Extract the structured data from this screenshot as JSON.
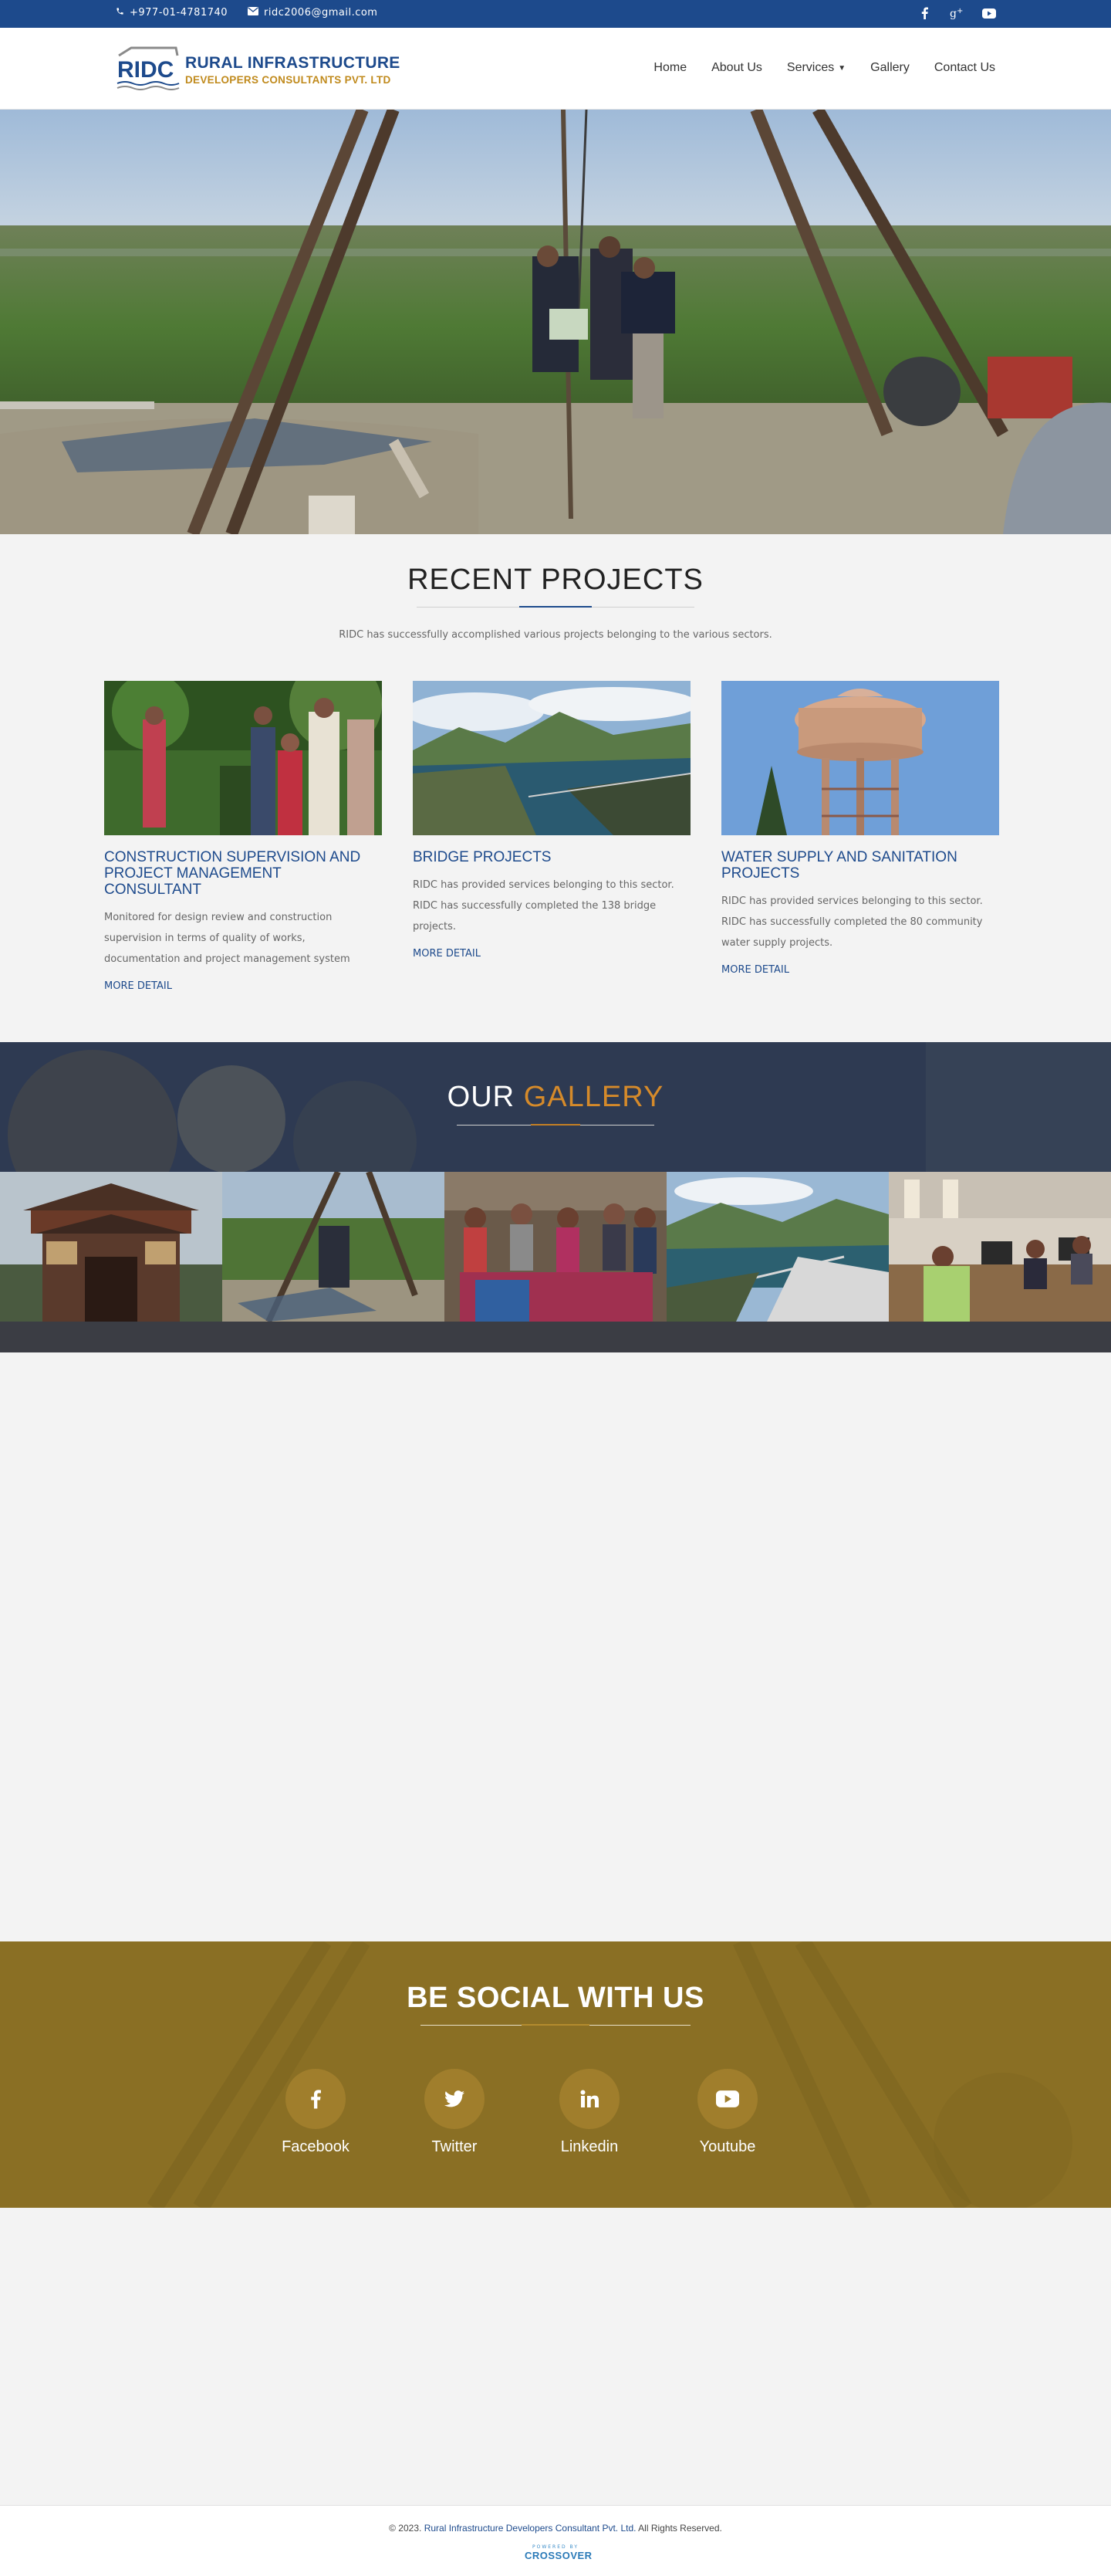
{
  "topbar": {
    "phone": "+977-01-4781740",
    "email": "ridc2006@gmail.com",
    "social_icons": [
      "facebook-icon",
      "google-plus-icon",
      "youtube-icon"
    ]
  },
  "header": {
    "logo_mark": "RIDC",
    "logo_line1": "RURAL INFRASTRUCTURE",
    "logo_line2": "DEVELOPERS CONSULTANTS PVT. LTD",
    "nav": [
      "Home",
      "About Us",
      "Services",
      "Gallery",
      "Contact Us"
    ]
  },
  "recent_projects": {
    "title": "RECENT PROJECTS",
    "subtitle": "RIDC has successfully accomplished various projects belonging to the various sectors.",
    "cards": [
      {
        "title": "CONSTRUCTION SUPERVISION AND PROJECT MANAGEMENT CONSULTANT",
        "text": "Monitored for design review and construction supervision in terms of quality of works, documentation and project management system",
        "more": "MORE DETAIL"
      },
      {
        "title": "BRIDGE PROJECTS",
        "text": "RIDC has provided services belonging to this sector. RIDC has successfully completed the 138 bridge projects.",
        "more": "MORE DETAIL"
      },
      {
        "title": "WATER SUPPLY AND SANITATION PROJECTS",
        "text": "RIDC has provided services belonging to this sector. RIDC has successfully completed the 80 community water supply projects.",
        "more": "MORE DETAIL"
      }
    ]
  },
  "gallery": {
    "title_part1": "OUR",
    "title_part2": "GALLERY"
  },
  "social": {
    "title": "BE SOCIAL WITH US",
    "items": [
      {
        "label": "Facebook",
        "icon": "facebook-icon"
      },
      {
        "label": "Twitter",
        "icon": "twitter-icon"
      },
      {
        "label": "Linkedin",
        "icon": "linkedin-icon"
      },
      {
        "label": "Youtube",
        "icon": "youtube-icon"
      }
    ]
  },
  "footer": {
    "copy_prefix": "© 2023.",
    "company": "Rural Infrastructure Developers Consultant Pvt. Ltd.",
    "copy_suffix": "All Rights Reserved.",
    "powered_by": "POWERED BY",
    "powered_brand": "CROSSOVER"
  },
  "colors": {
    "primary": "#1d4a8c",
    "accent_orange": "#c08a1c",
    "social_bg": "#8a6f24",
    "gallery_bg": "#2f3a50"
  }
}
